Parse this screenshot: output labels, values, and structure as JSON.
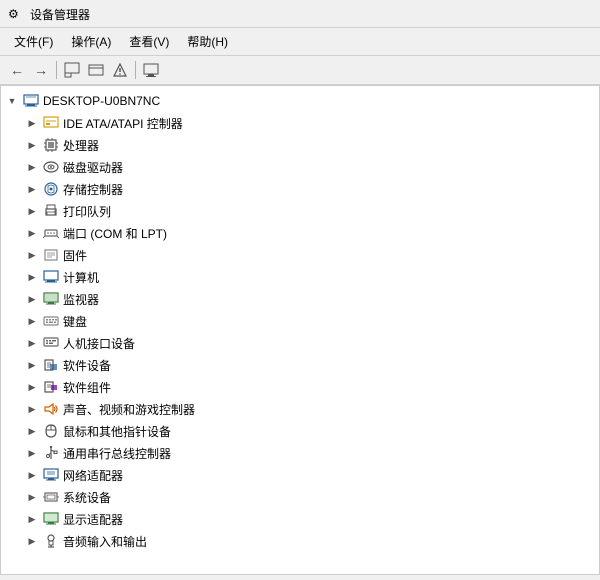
{
  "titleBar": {
    "icon": "⚙",
    "title": "设备管理器"
  },
  "menuBar": {
    "items": [
      {
        "label": "文件(F)"
      },
      {
        "label": "操作(A)"
      },
      {
        "label": "查看(V)"
      },
      {
        "label": "帮助(H)"
      }
    ]
  },
  "toolbar": {
    "buttons": [
      {
        "icon": "←",
        "name": "back",
        "disabled": false
      },
      {
        "icon": "→",
        "name": "forward",
        "disabled": false
      },
      {
        "icon": "⬜",
        "name": "up",
        "disabled": false
      },
      {
        "icon": "⬜",
        "name": "show",
        "disabled": false
      },
      {
        "icon": "⚡",
        "name": "action",
        "disabled": false
      },
      {
        "icon": "⬜",
        "name": "view",
        "disabled": false
      },
      {
        "icon": "🖥",
        "name": "monitor",
        "disabled": false
      }
    ]
  },
  "tree": {
    "root": {
      "label": "DESKTOP-U0BN7NC",
      "expanded": true
    },
    "items": [
      {
        "label": "IDE ATA/ATAPI 控制器",
        "icon": "ide",
        "expanded": false
      },
      {
        "label": "处理器",
        "icon": "cpu",
        "expanded": false
      },
      {
        "label": "磁盘驱动器",
        "icon": "disk",
        "expanded": false
      },
      {
        "label": "存储控制器",
        "icon": "storage",
        "expanded": false
      },
      {
        "label": "打印队列",
        "icon": "printer",
        "expanded": false
      },
      {
        "label": "端口 (COM 和 LPT)",
        "icon": "port",
        "expanded": false
      },
      {
        "label": "固件",
        "icon": "firmware",
        "expanded": false
      },
      {
        "label": "计算机",
        "icon": "computer",
        "expanded": false
      },
      {
        "label": "监视器",
        "icon": "monitor",
        "expanded": false
      },
      {
        "label": "键盘",
        "icon": "keyboard",
        "expanded": false
      },
      {
        "label": "人机接口设备",
        "icon": "hid",
        "expanded": false
      },
      {
        "label": "软件设备",
        "icon": "software",
        "expanded": false
      },
      {
        "label": "软件组件",
        "icon": "softcomp",
        "expanded": false
      },
      {
        "label": "声音、视频和游戏控制器",
        "icon": "sound",
        "expanded": false
      },
      {
        "label": "鼠标和其他指针设备",
        "icon": "mouse",
        "expanded": false
      },
      {
        "label": "通用串行总线控制器",
        "icon": "usb",
        "expanded": false
      },
      {
        "label": "网络适配器",
        "icon": "network",
        "expanded": false
      },
      {
        "label": "系统设备",
        "icon": "system",
        "expanded": false
      },
      {
        "label": "显示适配器",
        "icon": "display",
        "expanded": false
      },
      {
        "label": "音频输入和输出",
        "icon": "audio",
        "expanded": false
      }
    ]
  }
}
